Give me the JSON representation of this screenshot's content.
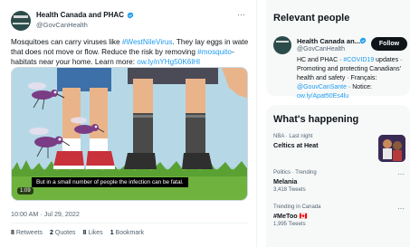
{
  "tweet": {
    "author_name": "Health Canada and PHAC",
    "author_handle": "@GovCanHealth",
    "more_label": "···",
    "text_lines": [
      [
        "Mosquitoes can carry viruses like ",
        "#WestNileVirus",
        ". They lay eggs in water"
      ],
      [
        "that does not move or flow. Reduce the risk by removing ",
        "#mosquito",
        "-"
      ],
      [
        "habitats near your home. Learn more: ",
        "ow.ly/nYHg50K6lHl",
        ""
      ]
    ],
    "video": {
      "caption": "But in a small number of people the infection can be fatal.",
      "time": "1:09"
    },
    "timestamp": "10:00 AM · Jul 29, 2022",
    "stats": [
      {
        "count": "8",
        "label": "Retweets"
      },
      {
        "count": "2",
        "label": "Quotes"
      },
      {
        "count": "8",
        "label": "Likes"
      },
      {
        "count": "1",
        "label": "Bookmark"
      }
    ]
  },
  "relevant_people": {
    "title": "Relevant people",
    "person": {
      "name": "Health Canada an...",
      "handle": "@GovCanHealth",
      "follow_label": "Follow",
      "bio_lines": [
        [
          "HC and PHAC · ",
          "#COVID19",
          " updates ·"
        ],
        [
          "Promoting and protecting Canadians'",
          "",
          ""
        ],
        [
          "health and safety · Français:",
          "",
          ""
        ],
        [
          "",
          "@GouvCanSante",
          " · Notice:"
        ],
        [
          "",
          "ow.ly/Apat50Es4lu",
          ""
        ]
      ]
    }
  },
  "whats_happening": {
    "title": "What's happening",
    "trends": [
      {
        "meta": "NBA · Last night",
        "title": "Celtics at Heat",
        "count": ""
      },
      {
        "meta": "Politics · Trending",
        "title": "Melania",
        "count": "3,418 Tweets"
      },
      {
        "meta": "Trending in Canada",
        "title": "#MeToo 🇨🇦",
        "count": "1,995 Tweets"
      }
    ]
  },
  "colors": {
    "link": "#1d9bf0",
    "verified": "#1d9bf0",
    "text": "#0f1419",
    "muted": "#536471"
  }
}
